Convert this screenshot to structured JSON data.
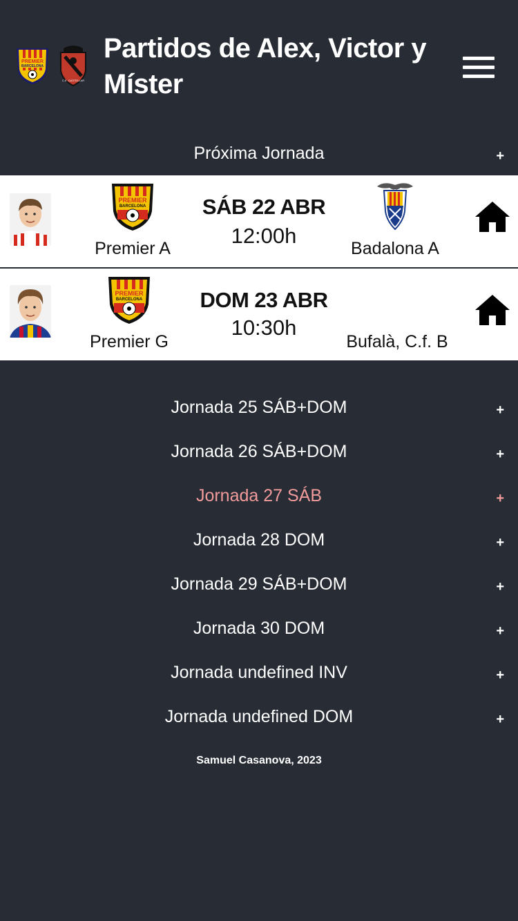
{
  "header": {
    "title": "Partidos de Alex, Victor y Míster",
    "logo1_text_top": "PREMIER",
    "logo1_text_bottom": "BARCELONA",
    "logo2_text": "C.E. CASTELLAR"
  },
  "next_section": {
    "label": "Próxima Jornada",
    "toggle": "+"
  },
  "matches": [
    {
      "team": "Premier A",
      "date": "SÁB 22 ABR",
      "time": "12:00h",
      "opponent": "Badalona A",
      "home_icon": "home-icon"
    },
    {
      "team": "Premier G",
      "date": "DOM 23 ABR",
      "time": "10:30h",
      "opponent": "Bufalà, C.f. B",
      "home_icon": "home-icon"
    }
  ],
  "jornadas": [
    {
      "label": "Jornada 25 SÁB+DOM",
      "toggle": "+"
    },
    {
      "label": "Jornada 26 SÁB+DOM",
      "toggle": "+"
    },
    {
      "label": "Jornada 27 SÁB",
      "toggle": "+"
    },
    {
      "label": "Jornada 28 DOM",
      "toggle": "+"
    },
    {
      "label": "Jornada 29 SÁB+DOM",
      "toggle": "+"
    },
    {
      "label": "Jornada 30 DOM",
      "toggle": "+"
    },
    {
      "label": "Jornada undefined INV",
      "toggle": "+"
    },
    {
      "label": "Jornada undefined DOM",
      "toggle": "+"
    }
  ],
  "footer": {
    "text": "Samuel Casanova, 2023"
  },
  "colors": {
    "background": "#282c35",
    "active_jornada": "#f29b9b",
    "card": "#ffffff"
  }
}
